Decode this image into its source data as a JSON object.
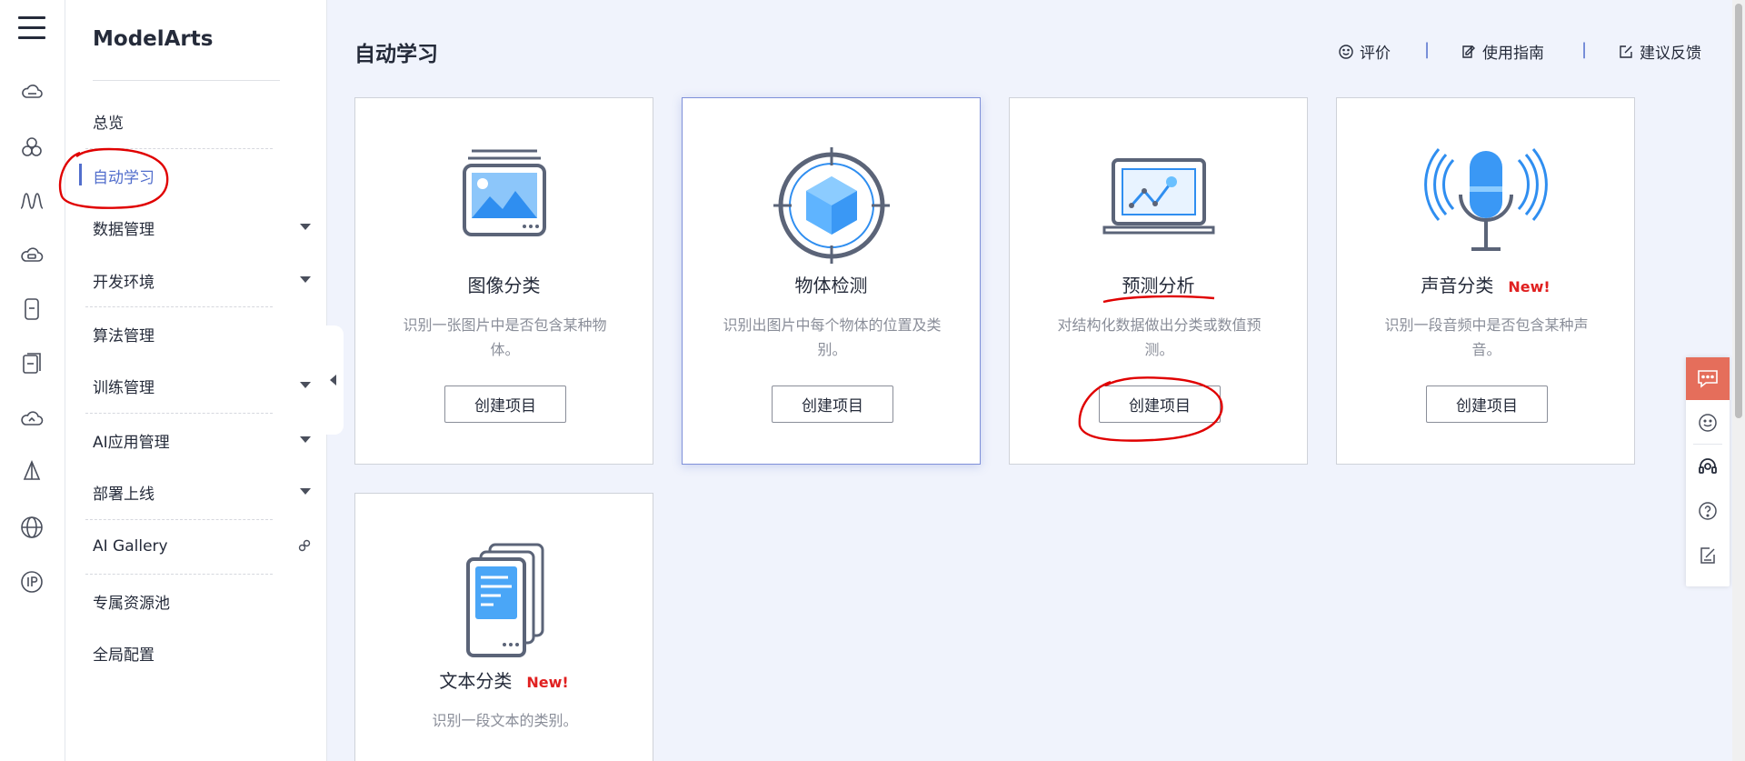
{
  "rail": {
    "icons": [
      "menu-icon",
      "cloud-server-icon",
      "cluster-icon",
      "waveform-icon",
      "cloud-database-icon",
      "mobile-icon",
      "tablet-icon",
      "cloud-refresh-icon",
      "lamp-icon",
      "globe-icon",
      "ip-icon"
    ]
  },
  "sidebar": {
    "brand": "ModelArts",
    "items": [
      {
        "label": "总览"
      },
      {
        "label": "自动学习"
      },
      {
        "label": "数据管理"
      },
      {
        "label": "开发环境"
      },
      {
        "label": "算法管理"
      },
      {
        "label": "训练管理"
      },
      {
        "label": "AI应用管理"
      },
      {
        "label": "部署上线"
      },
      {
        "label": "AI Gallery"
      },
      {
        "label": "专属资源池"
      },
      {
        "label": "全局配置"
      }
    ]
  },
  "header": {
    "title": "自动学习",
    "links": {
      "rate": "评价",
      "guide": "使用指南",
      "feedback": "建议反馈"
    },
    "separator": "|"
  },
  "cards": [
    {
      "title": "图像分类",
      "desc": "识别一张图片中是否包含某种物体。",
      "button": "创建项目"
    },
    {
      "title": "物体检测",
      "desc": "识别出图片中每个物体的位置及类别。",
      "button": "创建项目"
    },
    {
      "title": "预测分析",
      "desc": "对结构化数据做出分类或数值预测。",
      "button": "创建项目"
    },
    {
      "title": "声音分类",
      "badge": "New!",
      "desc": "识别一段音频中是否包含某种声音。",
      "button": "创建项目"
    },
    {
      "title": "文本分类",
      "badge": "New!",
      "desc": "识别一段文本的类别。"
    }
  ],
  "colors": {
    "accent": "#526ecc",
    "badge": "#e02020",
    "annotation": "#e00000",
    "chat": "#e56e5b"
  }
}
